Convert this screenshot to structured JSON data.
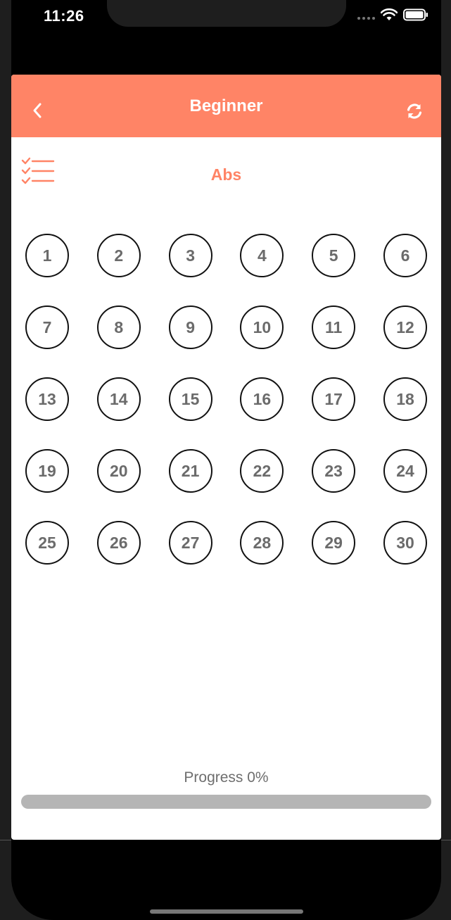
{
  "status_bar": {
    "time": "11:26"
  },
  "header": {
    "title": "Beginner",
    "back_icon": "chevron-left-icon",
    "refresh_icon": "refresh-icon",
    "accent_color": "#ff8466"
  },
  "section": {
    "title": "Abs",
    "list_icon": "checklist-icon"
  },
  "days": [
    "1",
    "2",
    "3",
    "4",
    "5",
    "6",
    "7",
    "8",
    "9",
    "10",
    "11",
    "12",
    "13",
    "14",
    "15",
    "16",
    "17",
    "18",
    "19",
    "20",
    "21",
    "22",
    "23",
    "24",
    "25",
    "26",
    "27",
    "28",
    "29",
    "30"
  ],
  "progress": {
    "label": "Progress 0%",
    "value": 0
  }
}
